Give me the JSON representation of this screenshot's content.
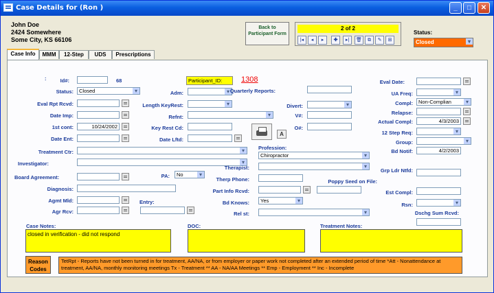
{
  "window": {
    "title": "Case Details for (Ron             )"
  },
  "header": {
    "name": "John Doe",
    "address1": "2424 Somewhere",
    "address2": "Some City, KS 66106",
    "back_button": "Back to Participant Form",
    "record": "2 of 2",
    "status_label": "Status:",
    "status_value": "Closed"
  },
  "tabs": [
    "Case Info",
    "MMM",
    "12-Step",
    "UDS",
    "Prescriptions"
  ],
  "form": {
    "colon": ":",
    "id_label": "Id#:",
    "id_value": "",
    "id_num": "68",
    "participant_id_label": "Participant_ID:",
    "participant_id_value": "1308",
    "status_label": "Status:",
    "status_value": "Closed",
    "eval_rpt_label": "Eval Rpt Rcvd:",
    "date_imp_label": "Date Imp:",
    "first_cont_label": "1st cont:",
    "first_cont_value": "10/24/2002",
    "date_ent_label": "Date Ent:",
    "treatment_ctr_label": "Treatment Ctr:",
    "investigator_label": "Investigator:",
    "board_agreement_label": "Board Agreement:",
    "diagnosis_label": "Diagnosis:",
    "agmt_mld_label": "Agmt Mld:",
    "agr_rcv_label": "Agr Rcv:",
    "adm_label": "Adm:",
    "length_keyrest_label": "Length KeyRest:",
    "refnt_label": "Refnt:",
    "key_rest_cd_label": "Key Rest Cd:",
    "date_lftd_label": "Date Lftd:",
    "pa_label": "PA:",
    "pa_value": "No",
    "entry_label": "Entry:",
    "quarterly_label": "Quarterly Reports:",
    "divert_label": "Divert:",
    "vnum_label": "V#:",
    "onum_label": "O#:",
    "profession_label": "Profession:",
    "profession_value": "Chiropractor",
    "therapist_label": "Therapist:",
    "therp_phone_label": "Therp Phone:",
    "part_info_label": "Part Info Rcvd:",
    "bd_knows_label": "Bd Knows:",
    "bd_knows_value": "Yes",
    "rel_st_label": "Rel st:",
    "poppy_label": "Poppy Seed on File:",
    "eval_date_label": "Eval Date:",
    "ua_freq_label": "UA Freq:",
    "compl_label": "Compl:",
    "compl_value": "Non-Complian",
    "relapse_label": "Relapse:",
    "actual_compl_label": "Actual Compl:",
    "actual_compl_value": "4/3/2003",
    "step_req_label": "12 Step Req:",
    "group_label": "Group:",
    "bd_notif_label": "Bd Notif:",
    "bd_notif_value": "4/2/2003",
    "grp_ldr_label": "Grp Ldr Ntfd:",
    "est_compl_label": "Est Compl:",
    "rsn_label": "Rsn:",
    "dschg_label": "Dschg Sum Rcvd:"
  },
  "notes": {
    "case_notes_label": "Case Notes:",
    "case_notes_value": "closed in verification - did not respond",
    "doc_label": "DOC:",
    "treatment_notes_label": "Treatment Notes:"
  },
  "reason": {
    "button": "Reason Codes",
    "text": "TetRpt - Reports have not been turned in for treatment, AA/NA, or from employer or paper work not completed after an extended period of time *Att - Nonattendance at treatment, AA/NA, monthly monitoring meetings  Tx - Treatment ** AA - NA/AA Meetings ** Emp - Employment ** Inc - Incomplete"
  },
  "colors": {
    "title_bar": "#0a5fe0",
    "highlight": "#ffff00",
    "status_closed": "#ff6a00",
    "reason_bg": "#ff9a2a",
    "label": "#1a3a9a"
  }
}
